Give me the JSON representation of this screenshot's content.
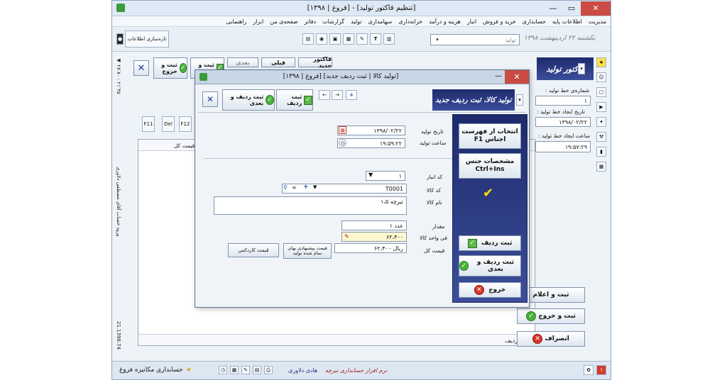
{
  "window": {
    "title": "[فروغ | ۱۳۹۸] - [تنظیم فاکتور تولید]"
  },
  "menu": [
    "مدیریت",
    "اطلاعات پایه",
    "حسابداری",
    "خرید و فروش",
    "انبار",
    "هزینه و درآمد",
    "خزانه‌داری",
    "سهامداری",
    "تولید",
    "گزارشات",
    "دفاتر",
    "صفحه‌ی من",
    "ابزار",
    "راهنمایی"
  ],
  "toolbar": {
    "memory_label": "تازه‌سازی اطلاعات",
    "date_text": "یکشنبه ۲۲ اردیبهشت ۱۳۹۸",
    "search_placeholder": "تولید"
  },
  "main_form": {
    "header_title": "فاکتور تولید",
    "new_invoice": "فاکتور جدید",
    "prev": "قبلی",
    "next": "بعدی",
    "save_new": "ثبت و جدید",
    "save_exit": "ثبت و خروج",
    "row_label": "ردیف",
    "total_col": "قیمت کل",
    "f11": "F11",
    "del": "Del",
    "f12": "F12",
    "line_no_label": "شماره‌ی خط تولید :",
    "line_no_value": "۱",
    "create_date_label": "تاریخ ایجاد خط تولید :",
    "create_date_value": "۱۳۹۸/۰۲/۲۲",
    "create_time_label": "ساعت ایجاد خط تولید :",
    "create_time_value": "۱۹:۵۷:۲۹",
    "save_announce": "ثبت و اعلام",
    "save_and_exit": "ثبت و خروج",
    "cancel": "انصراف",
    "side_vertical": "ورود حساب آقای مصطفی دلاوری",
    "version": "21.1398.74"
  },
  "dialog": {
    "title": "[فروغ | ۱۳۹۸] [تولید کالا | ثبت ردیف جدید]",
    "banner": "تولید کالا، ثبت ردیف جدید",
    "save": "ثبت ردیف",
    "save_next": "ثبت ردیف و بعدی",
    "prod_date_label": "تاریخ تولید",
    "prod_date": "۱۳۹۸/۰۲/۲۲",
    "prod_time_label": "ساعت تولید",
    "prod_time": "۱۹:۵۹:۲۲",
    "warehouse_label": "کد انبار",
    "warehouse_value": "۱",
    "item_code_label": "کد کالا",
    "item_code_value": "T0001",
    "item_name_label": "نام کالا",
    "item_name_value": "تیرچه ۱،۵",
    "qty_label": "مقدار",
    "qty_value": "۱ عدد",
    "unit_price_label": "فی واحد کالا",
    "unit_price_value": "۶۲،۴۰۰",
    "total_label": "قیمت کل",
    "total_value": "۶۲،۴۰۰ ریال",
    "cardex_btn": "قیمت کاردکس",
    "suggest_btn": "قیمت پیشنهادی بهای تمام شده تولید",
    "pick_list_btn": "انتخاب از فهرست اجناس F1",
    "spec_btn": "مشخصات جنس Ctrl+Ins",
    "row_save_btn": "ثبت ردیف",
    "row_save_next_btn": "ثبت ردیف و بعدی",
    "exit_btn": "خروج"
  },
  "statusbar": {
    "app_name": "حسابداری مکانیزه فروغ",
    "user": "هادی دلاوری",
    "brand": "نرم افزار حسابداری تیرچه"
  },
  "colors": {
    "navy": "#24317a",
    "green": "#49b33a",
    "red": "#d8352b"
  }
}
